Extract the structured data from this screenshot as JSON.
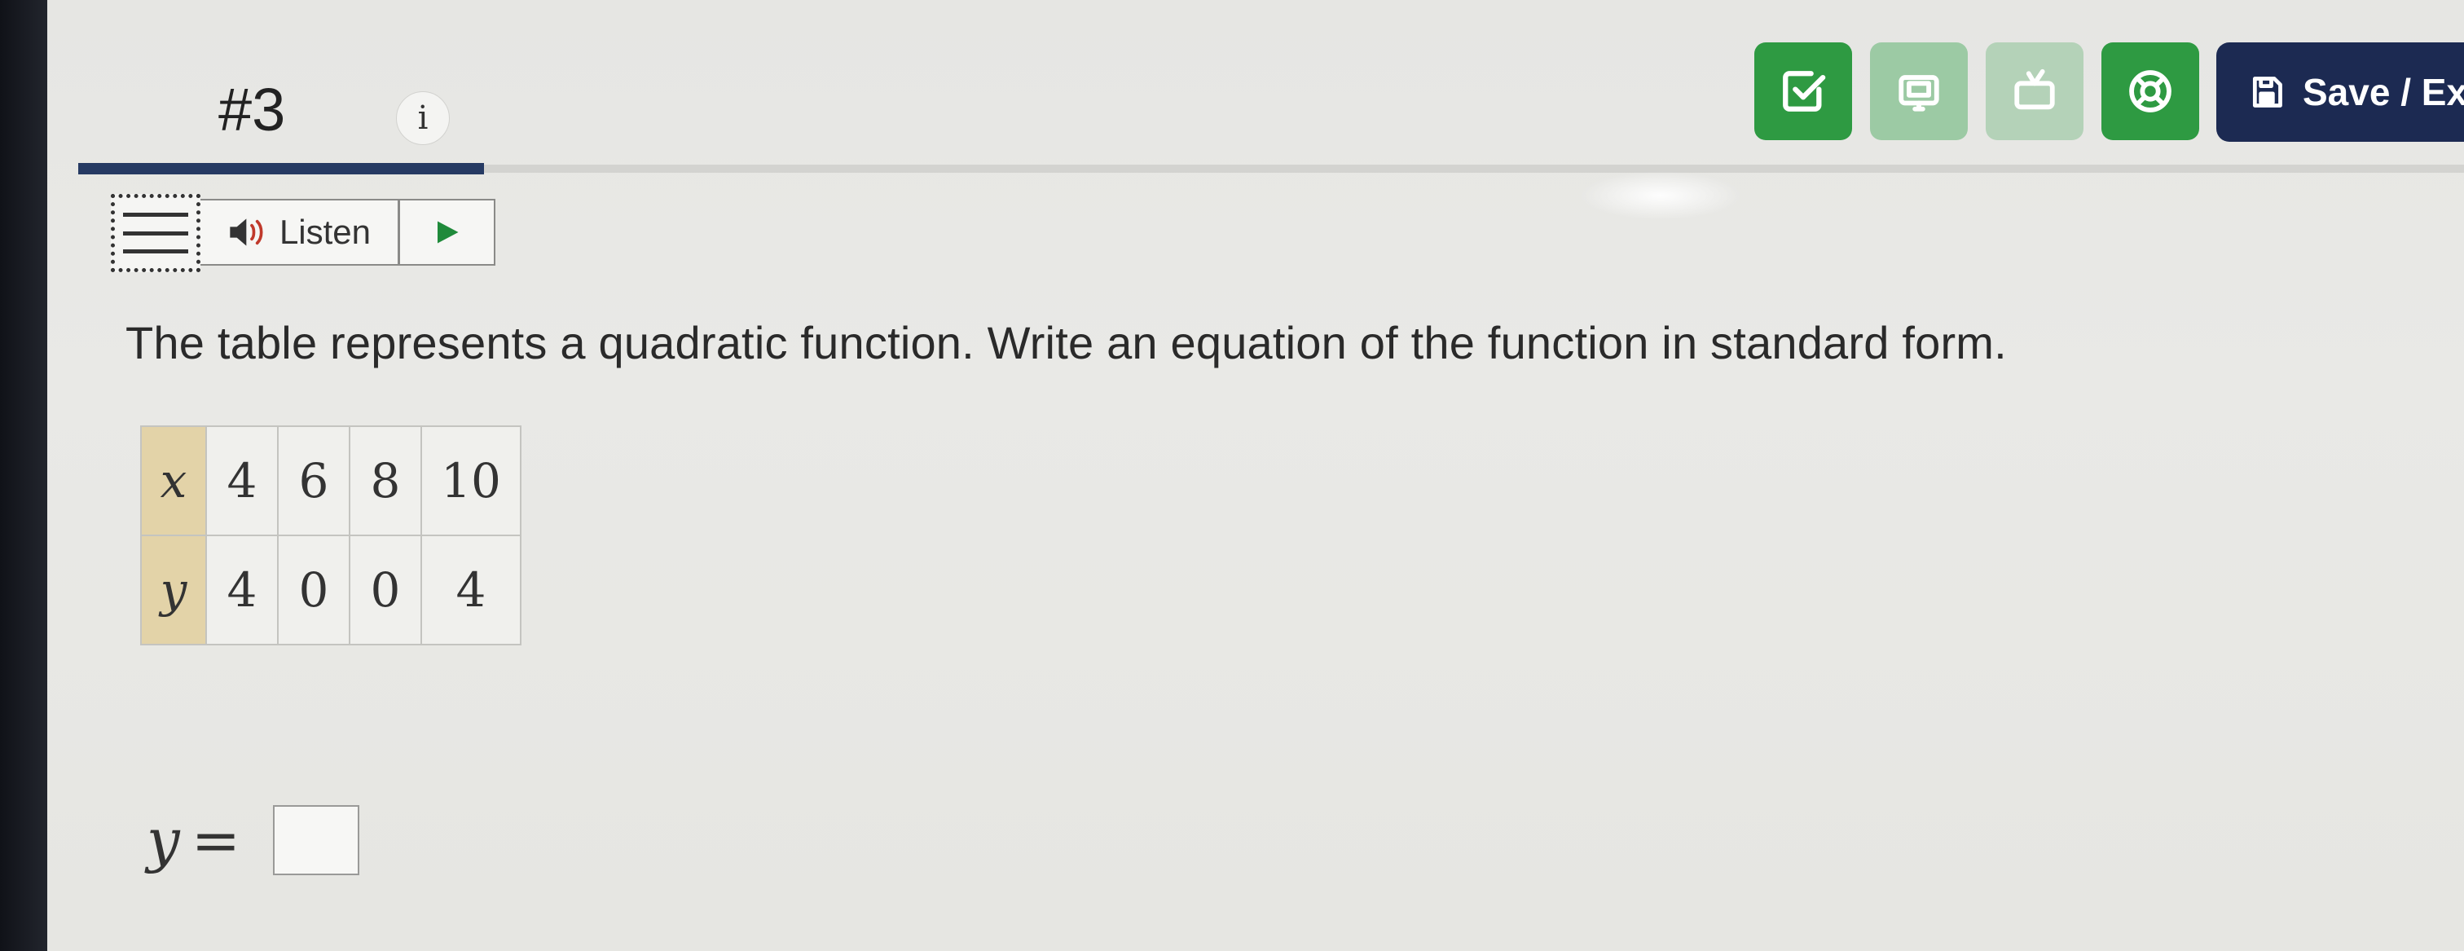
{
  "header": {
    "question_number": "#3",
    "info_label": "i"
  },
  "toolbar": {
    "buttons": [
      {
        "name": "check-answer",
        "icon": "check-square-icon",
        "color": "#2e9a42"
      },
      {
        "name": "calculator",
        "icon": "calculator-icon",
        "color": "#9ccaa4"
      },
      {
        "name": "video-help",
        "icon": "tv-icon",
        "color": "#b4d2b8"
      },
      {
        "name": "help",
        "icon": "lifebuoy-icon",
        "color": "#2e9a42"
      }
    ],
    "save_label": "Save / Exi",
    "save_icon": "floppy-disk-icon",
    "save_color": "#1c2a52"
  },
  "progress": {
    "fraction": 0.17,
    "color": "#263a63"
  },
  "listen": {
    "label": "Listen",
    "speaker_icon": "speaker-icon",
    "play_icon": "play-icon"
  },
  "question": {
    "text": "The table represents a quadratic function. Write an equation of the function in standard form."
  },
  "table": {
    "rows": [
      {
        "header": "x",
        "values": [
          "4",
          "6",
          "8",
          "10"
        ]
      },
      {
        "header": "y",
        "values": [
          "4",
          "0",
          "0",
          "4"
        ]
      }
    ]
  },
  "answer": {
    "variable": "y",
    "equals": "=",
    "value": ""
  }
}
